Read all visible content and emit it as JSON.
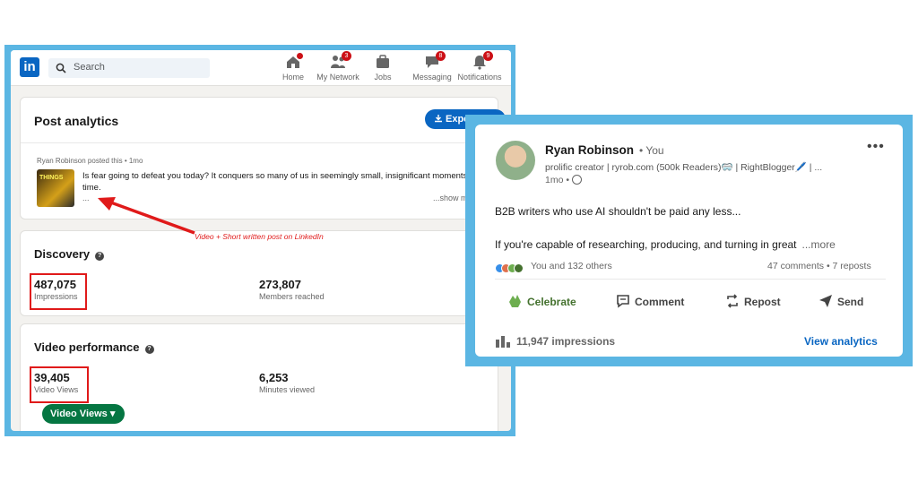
{
  "nav": {
    "logo": "in",
    "search_placeholder": "Search",
    "items": [
      {
        "label": "Home",
        "badge": ""
      },
      {
        "label": "My Network",
        "badge": "3"
      },
      {
        "label": "Jobs",
        "badge": ""
      },
      {
        "label": "Messaging",
        "badge": "8"
      },
      {
        "label": "Notifications",
        "badge": "9"
      }
    ]
  },
  "post_analytics": {
    "title": "Post analytics",
    "export_label": "Expo",
    "author_line": "Ryan Robinson posted this • 1mo",
    "thumb_text": "THINGS",
    "post_text": "Is fear going to defeat you today? It conquers so many of us in seemingly small, insignificant moments all the time.",
    "ellipsis": "...",
    "show_more": "...show m"
  },
  "annotation": "Video + Short written post on LinkedIn",
  "discovery": {
    "title": "Discovery",
    "impressions": {
      "value": "487,075",
      "label": "Impressions"
    },
    "members": {
      "value": "273,807",
      "label": "Members reached"
    }
  },
  "video": {
    "title": "Video performance",
    "views": {
      "value": "39,405",
      "label": "Video Views"
    },
    "minutes": {
      "value": "6,253",
      "label": "Minutes viewed"
    },
    "button_label": "Video Views ▾"
  },
  "post": {
    "name": "Ryan Robinson",
    "you": "• You",
    "headline": "prolific creator | ryrob.com (500k Readers)🥽 | RightBlogger🖊️ | ...",
    "time": "1mo •",
    "body_line1": "B2B writers who use AI shouldn't be paid any less...",
    "body_line2": "If you're capable of researching, producing, and turning in great",
    "more": "...more",
    "reactors": "You and 132 others",
    "stats": "47 comments • 7 reposts",
    "actions": [
      "Celebrate",
      "Comment",
      "Repost",
      "Send"
    ],
    "impressions": "11,947 impressions",
    "view_analytics": "View analytics"
  },
  "colors": {
    "frame": "#5bb6e3",
    "linkedin_blue": "#0a66c2",
    "green": "#057642",
    "annotation_red": "#e01a1a"
  }
}
